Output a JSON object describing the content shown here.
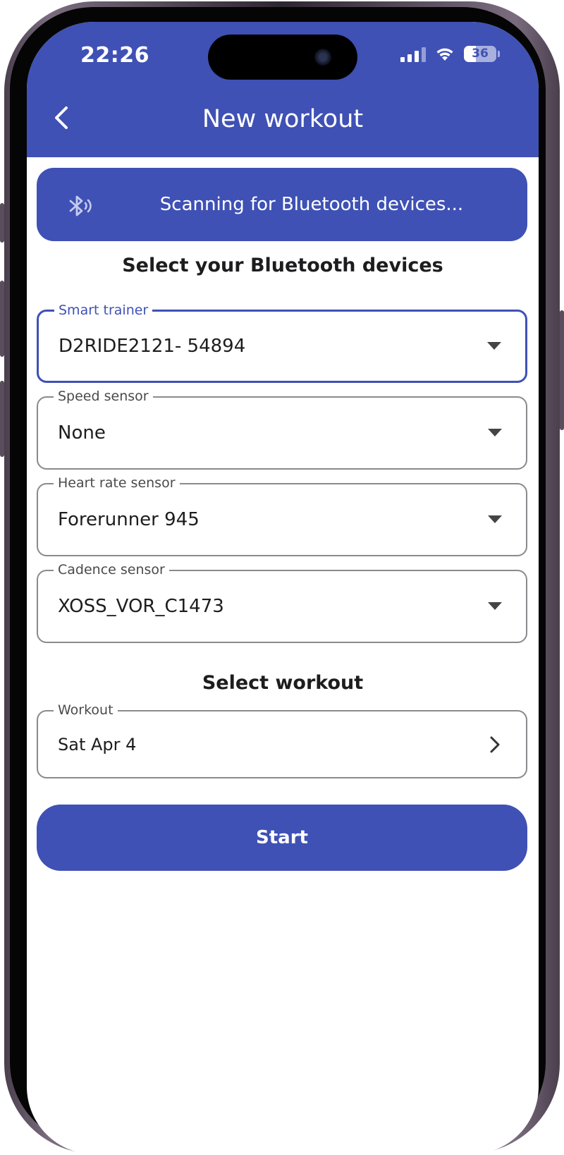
{
  "status_bar": {
    "time": "22:26",
    "battery": "36"
  },
  "header": {
    "title": "New workout",
    "back_icon": "chevron-left-icon"
  },
  "scan_banner": {
    "icon": "bluetooth-searching-icon",
    "text": "Scanning for Bluetooth devices..."
  },
  "devices_section": {
    "title": "Select your Bluetooth devices",
    "fields": [
      {
        "label": "Smart trainer",
        "value": "D2RIDE2121- 54894"
      },
      {
        "label": "Speed sensor",
        "value": "None"
      },
      {
        "label": "Heart rate sensor",
        "value": "Forerunner 945"
      },
      {
        "label": "Cadence sensor",
        "value": "XOSS_VOR_C1473"
      }
    ]
  },
  "workout_section": {
    "title": "Select workout",
    "field": {
      "label": "Workout",
      "value": "Sat Apr 4"
    }
  },
  "start_button": {
    "label": "Start"
  },
  "colors": {
    "accent": "#3f51b5",
    "text": "#1d1d1f",
    "border": "#8a8a8e"
  }
}
